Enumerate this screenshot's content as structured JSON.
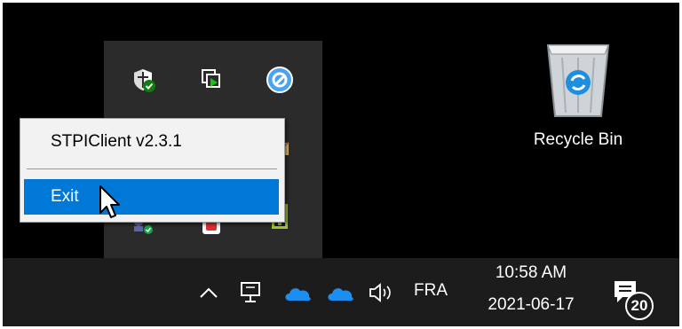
{
  "context_menu": {
    "items": [
      {
        "label": "STPIClient v2.3.1",
        "highlighted": false
      },
      {
        "label": "Exit",
        "highlighted": true
      }
    ]
  },
  "tray_overflow": {
    "icons": [
      "security-shield-icon",
      "remote-screen-icon",
      "blue-circle-app-icon",
      "folder-icon",
      "network-users-icon",
      "red-app-icon",
      "green-app-icon"
    ]
  },
  "desktop": {
    "recycle_bin_label": "Recycle Bin"
  },
  "taskbar": {
    "language": "FRA",
    "time": "10:58 AM",
    "date": "2021-06-17",
    "notification_count": "20",
    "icons": [
      "show-hidden-chevron-icon",
      "network-icon",
      "onedrive-cloud-icon",
      "onedrive-cloud-icon",
      "volume-icon",
      "action-center-icon"
    ]
  },
  "colors": {
    "highlight": "#0078d7",
    "taskbar": "#1c1c1c",
    "flyout": "#2b2b2b"
  }
}
